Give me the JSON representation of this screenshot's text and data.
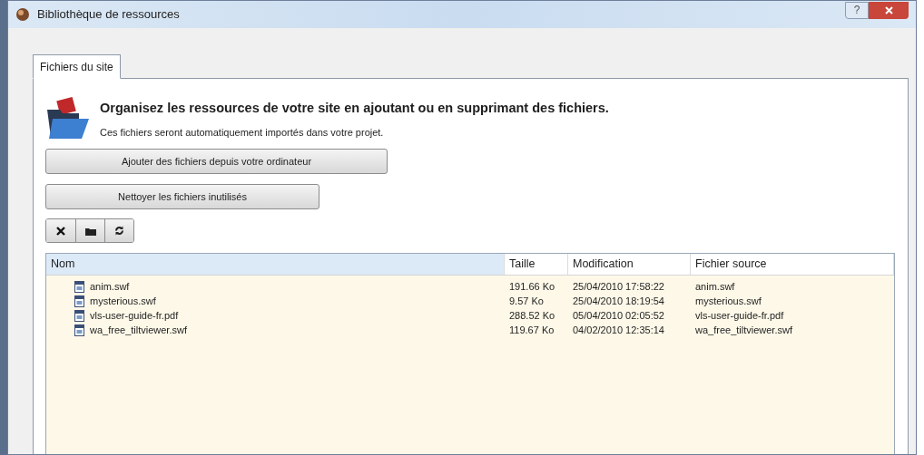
{
  "window": {
    "title": "Bibliothèque de ressources",
    "help": "?"
  },
  "tabs": [
    {
      "label": "Fichiers du site",
      "selected": true
    }
  ],
  "header": {
    "title": "Organisez les ressources de votre site en ajoutant ou en supprimant des fichiers.",
    "subtitle": "Ces fichiers seront automatiquement importés dans votre projet."
  },
  "buttons": [
    {
      "label": "Ajouter des fichiers depuis votre ordinateur"
    },
    {
      "label": "Nettoyer les fichiers inutilisés"
    }
  ],
  "toolbar": [
    {
      "kind": "delete"
    },
    {
      "kind": "folder"
    },
    {
      "kind": "refresh"
    }
  ],
  "table": {
    "columns": [
      "Nom",
      "Taille",
      "Modification",
      "Fichier source"
    ],
    "rows": [
      {
        "name": "anim.swf",
        "size": "191.66 Ko",
        "modified": "25/04/2010 17:58:22",
        "source": "anim.swf"
      },
      {
        "name": "mysterious.swf",
        "size": "9.57 Ko",
        "modified": "25/04/2010 18:19:54",
        "source": "mysterious.swf"
      },
      {
        "name": "vls-user-guide-fr.pdf",
        "size": "288.52 Ko",
        "modified": "05/04/2010 02:05:52",
        "source": "vls-user-guide-fr.pdf"
      },
      {
        "name": "wa_free_tiltviewer.swf",
        "size": "119.67 Ko",
        "modified": "04/02/2010 12:35:14",
        "source": "wa_free_tiltviewer.swf"
      }
    ]
  }
}
